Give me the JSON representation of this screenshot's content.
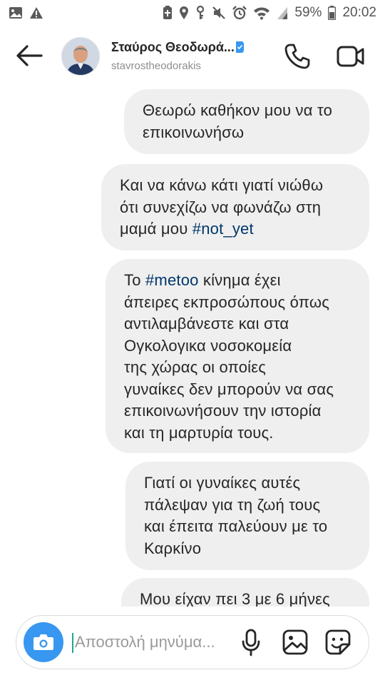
{
  "status_bar": {
    "battery": "59%",
    "time": "20:02"
  },
  "header": {
    "name": "Σταύρος Θεοδωρά...",
    "username": "stavrostheodorakis"
  },
  "messages": [
    {
      "lines": [
        [
          {
            "t": "Θεωρώ καθήκον μου να το"
          }
        ],
        [
          {
            "t": "επικοινωνήσω"
          }
        ]
      ]
    },
    {
      "lines": [
        [
          {
            "t": "Και να κάνω κάτι γιατί νιώθω"
          }
        ],
        [
          {
            "t": "ότι συνεχίζω να φωνάζω στη"
          }
        ],
        [
          {
            "t": "μαμά μου "
          },
          {
            "t": "#not_yet",
            "tag": true
          }
        ]
      ]
    },
    {
      "lines": [
        [
          {
            "t": "Το "
          },
          {
            "t": "#metoo",
            "tag": true
          },
          {
            "t": " κίνημα έχει"
          }
        ],
        [
          {
            "t": "άπειρες εκπροσώπους όπως"
          }
        ],
        [
          {
            "t": "αντιλαμβάνεστε και στα"
          }
        ],
        [
          {
            "t": "Ογκολογικα νοσοκομεία"
          }
        ],
        [
          {
            "t": "της χώρας οι οποίες"
          }
        ],
        [
          {
            "t": "γυναίκες δεν μπορούν να σας"
          }
        ],
        [
          {
            "t": "επικοινωνήσουν την ιστορία"
          }
        ],
        [
          {
            "t": "και τη μαρτυρία τους."
          }
        ]
      ]
    },
    {
      "lines": [
        [
          {
            "t": "Γιατί οι γυναίκες αυτές"
          }
        ],
        [
          {
            "t": "πάλεψαν για τη ζωή τους"
          }
        ],
        [
          {
            "t": "και έπειτα παλεύουν με το"
          }
        ],
        [
          {
            "t": "Καρκίνο"
          }
        ]
      ]
    },
    {
      "lines": [
        [
          {
            "t": "Μου είχαν πει 3 με 6 μήνες"
          }
        ]
      ]
    }
  ],
  "composer": {
    "placeholder": "Αποστολή μηνύμα..."
  },
  "colors": {
    "bubble": "#efefef",
    "hashtag": "#00376b",
    "camera_button": "#3897f0"
  },
  "icons": [
    "back-arrow-icon",
    "verified-badge-icon",
    "phone-icon",
    "video-camera-icon",
    "camera-icon",
    "microphone-icon",
    "gallery-icon",
    "sticker-icon"
  ]
}
